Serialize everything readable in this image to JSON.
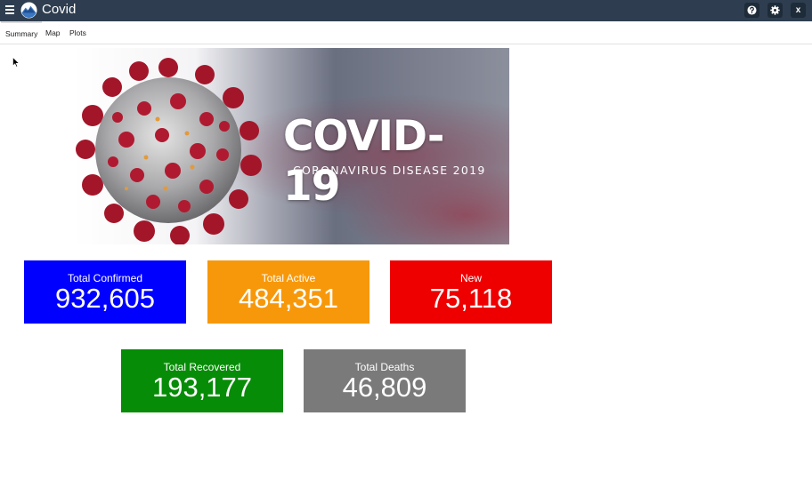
{
  "app": {
    "title": "Covid",
    "icons": {
      "menu": "hamburger-menu-icon",
      "logo": "mountain-globe-logo-icon",
      "help": "question-mark-icon",
      "settings": "gear-icon",
      "close": "close-icon"
    },
    "close_label": "x",
    "header_color": "#2e3e50"
  },
  "tabs": [
    {
      "label": "Summary",
      "active": true
    },
    {
      "label": "Map",
      "active": false
    },
    {
      "label": "Plots",
      "active": false
    }
  ],
  "banner": {
    "title": "COVID-19",
    "subtitle": "CORONAVIRUS DISEASE 2019"
  },
  "stats": {
    "confirmed": {
      "label": "Total Confirmed",
      "value": "932,605",
      "color": "#0000ff"
    },
    "active": {
      "label": "Total Active",
      "value": "484,351",
      "color": "#f7980a"
    },
    "new": {
      "label": "New",
      "value": "75,118",
      "color": "#ee0000"
    },
    "recovered": {
      "label": "Total Recovered",
      "value": "193,177",
      "color": "#078c07"
    },
    "deaths": {
      "label": "Total Deaths",
      "value": "46,809",
      "color": "#7a7a7a"
    }
  }
}
